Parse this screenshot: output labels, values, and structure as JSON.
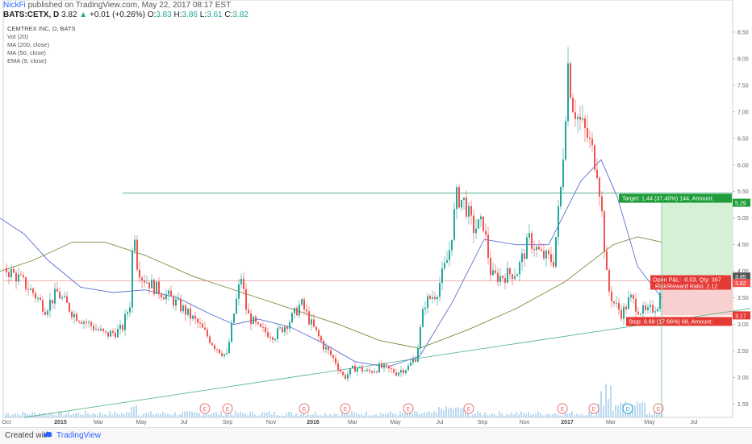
{
  "header": {
    "author": "NickFi",
    "published": "published on TradingView.com, May 22, 2017 08:17 EST",
    "symbol": "BATS:CETX, D",
    "last": "3.82",
    "change": "+0.01 (+0.26%)",
    "o_label": "O:",
    "o": "3.83",
    "h_label": "H:",
    "h": "3.86",
    "l_label": "L:",
    "l": "3.61",
    "c_label": "C:",
    "c": "3.82"
  },
  "footer": {
    "created": "Created with",
    "brand": "TradingView"
  },
  "colors": {
    "up": "#26a69a",
    "down": "#ef5350",
    "ma200": "#7a8a3c",
    "ma50": "#5a6fd6",
    "trend": "#5cb88a",
    "target_fill": "#d6f0d6",
    "stop_fill": "#f8d0d0",
    "target_label": "#1f9d3a",
    "stop_label": "#e53935",
    "volume": "#a9d2ee"
  },
  "chart_data": {
    "type": "candlestick",
    "title": "CEMTREX INC, D, BATS",
    "indicators": [
      "Vol (20)",
      "MA (200, close)",
      "MA (50, close)",
      "EMA (9, close)"
    ],
    "x_ticks": [
      "Oct",
      "2015",
      "Mar",
      "May",
      "Jul",
      "Sep",
      "Nov",
      "2016",
      "Mar",
      "May",
      "Jul",
      "Sep",
      "Nov",
      "2017",
      "Mar",
      "May",
      "Jul"
    ],
    "y_ticks": [
      "1.50",
      "2.00",
      "2.50",
      "3.00",
      "3.50",
      "4.00",
      "4.50",
      "5.00",
      "5.50",
      "6.00",
      "6.50",
      "7.00",
      "7.50",
      "8.00",
      "8.50"
    ],
    "ylim": [
      1.25,
      8.65
    ],
    "price_path": [
      [
        0,
        4.1
      ],
      [
        20,
        3.9
      ],
      [
        40,
        3.6
      ],
      [
        55,
        3.3
      ],
      [
        70,
        3.6
      ],
      [
        90,
        3.2
      ],
      [
        110,
        3.0
      ],
      [
        130,
        2.8
      ],
      [
        150,
        2.9
      ],
      [
        160,
        3.4
      ],
      [
        165,
        5.0
      ],
      [
        168,
        4.2
      ],
      [
        175,
        3.9
      ],
      [
        190,
        3.7
      ],
      [
        210,
        3.5
      ],
      [
        225,
        3.3
      ],
      [
        245,
        3.0
      ],
      [
        265,
        2.6
      ],
      [
        280,
        2.4
      ],
      [
        290,
        3.3
      ],
      [
        298,
        3.9
      ],
      [
        305,
        3.2
      ],
      [
        320,
        2.9
      ],
      [
        340,
        2.8
      ],
      [
        360,
        3.1
      ],
      [
        372,
        3.4
      ],
      [
        385,
        3.0
      ],
      [
        400,
        2.6
      ],
      [
        415,
        2.3
      ],
      [
        425,
        2.0
      ],
      [
        440,
        2.2
      ],
      [
        455,
        2.1
      ],
      [
        470,
        2.2
      ],
      [
        490,
        2.1
      ],
      [
        505,
        2.2
      ],
      [
        515,
        2.4
      ],
      [
        525,
        3.4
      ],
      [
        540,
        3.6
      ],
      [
        555,
        4.3
      ],
      [
        565,
        5.4
      ],
      [
        575,
        5.3
      ],
      [
        585,
        4.8
      ],
      [
        598,
        4.9
      ],
      [
        608,
        3.9
      ],
      [
        620,
        3.9
      ],
      [
        640,
        4.0
      ],
      [
        655,
        4.6
      ],
      [
        670,
        4.3
      ],
      [
        685,
        4.2
      ],
      [
        695,
        5.7
      ],
      [
        703,
        7.9
      ],
      [
        708,
        7.2
      ],
      [
        715,
        6.9
      ],
      [
        728,
        6.5
      ],
      [
        740,
        5.9
      ],
      [
        746,
        4.9
      ],
      [
        752,
        3.7
      ],
      [
        760,
        3.4
      ],
      [
        770,
        3.2
      ],
      [
        780,
        3.5
      ],
      [
        790,
        3.3
      ],
      [
        800,
        3.2
      ],
      [
        808,
        3.3
      ],
      [
        815,
        3.4
      ],
      [
        820,
        3.82
      ]
    ],
    "ma200": [
      [
        0,
        4.0
      ],
      [
        40,
        4.2
      ],
      [
        90,
        4.55
      ],
      [
        130,
        4.55
      ],
      [
        180,
        4.3
      ],
      [
        240,
        3.9
      ],
      [
        300,
        3.6
      ],
      [
        360,
        3.3
      ],
      [
        420,
        3.0
      ],
      [
        470,
        2.7
      ],
      [
        520,
        2.55
      ],
      [
        580,
        2.9
      ],
      [
        640,
        3.3
      ],
      [
        700,
        3.8
      ],
      [
        760,
        4.5
      ],
      [
        790,
        4.65
      ],
      [
        820,
        4.55
      ]
    ],
    "ma50": [
      [
        0,
        5.0
      ],
      [
        30,
        4.7
      ],
      [
        60,
        4.2
      ],
      [
        100,
        3.7
      ],
      [
        140,
        3.6
      ],
      [
        180,
        3.65
      ],
      [
        220,
        3.5
      ],
      [
        260,
        3.2
      ],
      [
        290,
        3.0
      ],
      [
        320,
        3.1
      ],
      [
        360,
        2.95
      ],
      [
        400,
        2.65
      ],
      [
        440,
        2.3
      ],
      [
        480,
        2.2
      ],
      [
        520,
        2.4
      ],
      [
        560,
        3.4
      ],
      [
        600,
        4.6
      ],
      [
        640,
        4.5
      ],
      [
        680,
        4.5
      ],
      [
        720,
        5.7
      ],
      [
        745,
        6.1
      ],
      [
        765,
        5.4
      ],
      [
        790,
        4.1
      ],
      [
        820,
        3.5
      ]
    ],
    "trendline": [
      [
        30,
        1.25
      ],
      [
        930,
        3.3
      ]
    ],
    "horizontal_level": 5.47,
    "entry_price": 3.82,
    "target_price": 5.29,
    "stop_price": 3.17,
    "right_labels": [
      "5.29",
      "3.85",
      "3.82",
      "3.17"
    ],
    "target_label": "Target: 1.44 (37.40%) 144, Amount:",
    "open_pnl_label": "Open P&L: -0.03, Qty: 367",
    "risk_reward_label": "Risk/Reward Ratio: 2.12",
    "stop_label": "Stop: 0.68 (17.66%) 68, Amount:",
    "event_markers": [
      "E",
      "E",
      "E",
      "E",
      "E",
      "E",
      "E",
      "E",
      "D",
      "E"
    ]
  }
}
